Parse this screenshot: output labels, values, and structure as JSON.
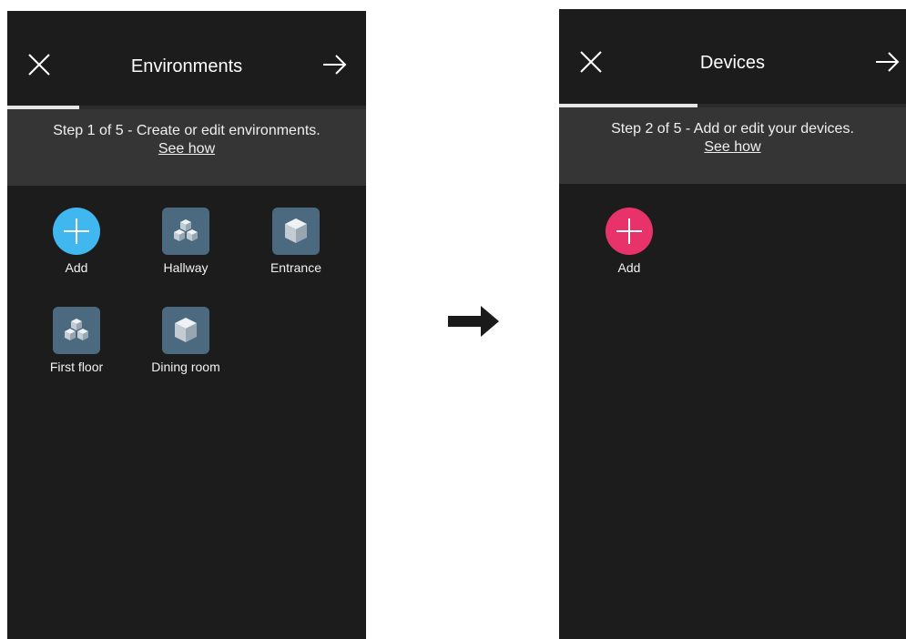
{
  "screens": [
    {
      "title": "Environments",
      "step_text": "Step 1 of 5 - Create or edit environments.",
      "see_how": "See how",
      "progress": 0.2,
      "tiles": [
        {
          "label": "Add",
          "icon": "add-icon",
          "color": "#41b7f0"
        },
        {
          "label": "Hallway",
          "icon": "multi-cube-icon"
        },
        {
          "label": "Entrance",
          "icon": "cube-icon"
        },
        {
          "label": "First floor",
          "icon": "multi-cube-icon"
        },
        {
          "label": "Dining room",
          "icon": "cube-icon"
        }
      ]
    },
    {
      "title": "Devices",
      "step_text": "Step 2 of 5 - Add or edit your devices.",
      "see_how": "See how",
      "progress": 0.4,
      "tiles": [
        {
          "label": "Add",
          "icon": "add-icon",
          "color": "#e8336a"
        }
      ]
    }
  ],
  "colors": {
    "screen_background": "#1c1c1d",
    "step_band": "#353536",
    "environment_icon": "#4b6a80"
  }
}
